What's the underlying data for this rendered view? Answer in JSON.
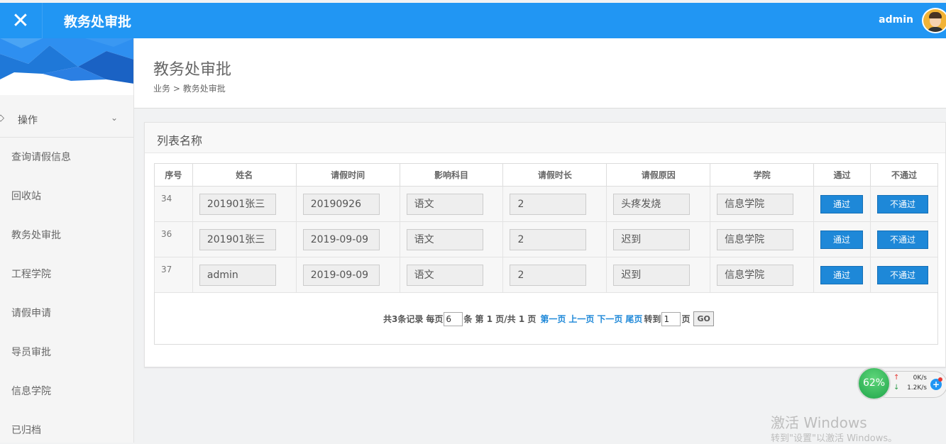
{
  "topbar": {
    "close_glyph": "✕",
    "title": "教务处审批",
    "user": "admin"
  },
  "sidebar": {
    "group_label": "操作",
    "items": [
      {
        "label": "查询请假信息"
      },
      {
        "label": "回收站"
      },
      {
        "label": "教务处审批"
      },
      {
        "label": "工程学院"
      },
      {
        "label": "请假申请"
      },
      {
        "label": "导员审批"
      },
      {
        "label": "信息学院"
      },
      {
        "label": "已归档"
      }
    ]
  },
  "header": {
    "page_title": "教务处审批",
    "breadcrumb": [
      "业务",
      "教务处审批"
    ],
    "breadcrumb_sep": ">"
  },
  "panel": {
    "title": "列表名称",
    "columns": [
      "序号",
      "姓名",
      "请假时间",
      "影响科目",
      "请假时长",
      "请假原因",
      "学院",
      "通过",
      "不通过"
    ],
    "rows": [
      {
        "id": "34",
        "name": "201901张三",
        "date": "20190926",
        "subject": "语文",
        "duration": "2",
        "reason": "头疼发烧",
        "college": "信息学院",
        "approve": "通过",
        "reject": "不通过"
      },
      {
        "id": "36",
        "name": "201901张三",
        "date": "2019-09-09",
        "subject": "语文",
        "duration": "2",
        "reason": "迟到",
        "college": "信息学院",
        "approve": "通过",
        "reject": "不通过"
      },
      {
        "id": "37",
        "name": "admin",
        "date": "2019-09-09",
        "subject": "语文",
        "duration": "2",
        "reason": "迟到",
        "college": "信息学院",
        "approve": "通过",
        "reject": "不通过"
      }
    ]
  },
  "pager": {
    "total_text": "共3条记录",
    "per_page_label": "每页",
    "per_page_value": "6",
    "page_info": "条 第 1 页/共 1 页",
    "first": "第一页",
    "prev": "上一页",
    "next": "下一页",
    "last": "尾页",
    "goto_label": "转到",
    "goto_value": "1",
    "page_unit": "页",
    "go_label": "GO"
  },
  "net_monitor": {
    "percent": "62%",
    "upload": "0K/s",
    "download": "1.2K/s"
  },
  "watermark": {
    "title": "激活 Windows",
    "subtitle": "转到\"设置\"以激活 Windows。"
  },
  "colors": {
    "topbar": "#2196f3",
    "button": "#1e88d8",
    "link": "#1e88d8"
  }
}
